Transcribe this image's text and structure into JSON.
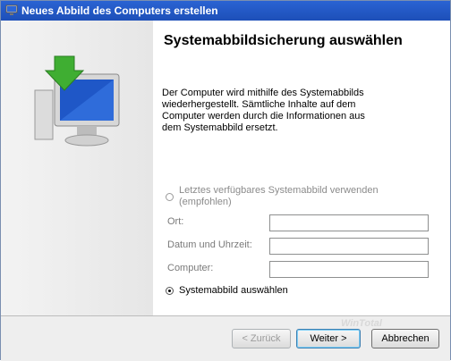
{
  "window": {
    "title": "Neues Abbild des Computers erstellen"
  },
  "page": {
    "heading": "Systemabbildsicherung auswählen",
    "description": "Der Computer wird mithilfe des Systemabbilds wiederhergestellt. Sämtliche Inhalte auf dem Computer werden durch die Informationen aus dem Systemabbild ersetzt."
  },
  "options": {
    "latest_label": "Letztes verfügbares Systemabbild verwenden (empfohlen)",
    "latest_selected": false,
    "latest_enabled": false,
    "location_label": "Ort:",
    "location_value": "",
    "datetime_label": "Datum und Uhrzeit:",
    "datetime_value": "",
    "computer_label": "Computer:",
    "computer_value": "",
    "select_label": "Systemabbild auswählen",
    "select_selected": true
  },
  "buttons": {
    "back": "< Zurück",
    "next": "Weiter >",
    "cancel": "Abbrechen"
  },
  "watermark": "WinTotal",
  "icons": {
    "app": "computer-restore-icon",
    "side": "computer-restore-illustration"
  },
  "colors": {
    "titlebar": "#1d4fb8",
    "arrow_green": "#3fae32",
    "screen_blue": "#1f57c7"
  }
}
